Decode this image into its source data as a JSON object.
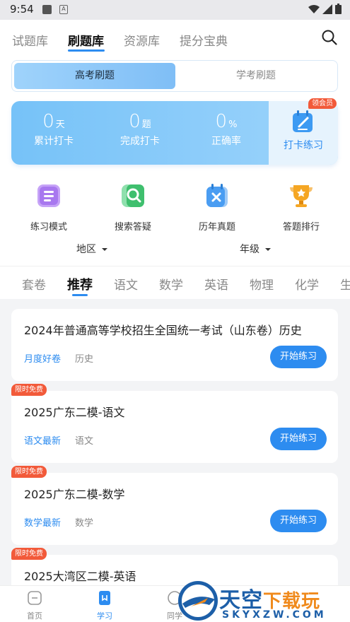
{
  "status_bar": {
    "time": "9:54",
    "sim_icon_letter": "A"
  },
  "top_nav": {
    "tabs": [
      {
        "label": "试题库",
        "active": false
      },
      {
        "label": "刷题库",
        "active": true
      },
      {
        "label": "资源库",
        "active": false
      },
      {
        "label": "提分宝典",
        "active": false
      }
    ],
    "search_icon": "search-icon"
  },
  "segment": {
    "options": [
      "高考刷题",
      "学考刷题"
    ],
    "selected": 0
  },
  "stats": {
    "items": [
      {
        "value": "0",
        "unit": "天",
        "label": "累计打卡"
      },
      {
        "value": "0",
        "unit": "题",
        "label": "完成打卡"
      },
      {
        "value": "0",
        "unit": "%",
        "label": "正确率"
      }
    ],
    "checkin_label": "打卡练习",
    "vip_badge": "领会员"
  },
  "quick_actions": [
    {
      "label": "练习模式",
      "icon": "practice-mode-icon",
      "color": "#b486f3"
    },
    {
      "label": "搜索答疑",
      "icon": "search-answer-icon",
      "color": "#4cc77a"
    },
    {
      "label": "历年真题",
      "icon": "past-papers-icon",
      "color": "#4a9df2"
    },
    {
      "label": "答题排行",
      "icon": "trophy-icon",
      "color": "#f5a623"
    }
  ],
  "filters": {
    "region": "地区",
    "grade": "年级"
  },
  "subject_tabs": [
    "套卷",
    "推荐",
    "语文",
    "数学",
    "英语",
    "物理",
    "化学",
    "生"
  ],
  "subject_tab_active": 1,
  "cards": [
    {
      "title": "2024年普通高等学校招生全国统一考试（山东卷）历史",
      "tag": "月度好卷",
      "subject": "历史",
      "button": "开始练习",
      "badge": ""
    },
    {
      "title": "2025广东二模-语文",
      "tag": "语文最新",
      "subject": "语文",
      "button": "开始练习",
      "badge": "限时免费"
    },
    {
      "title": "2025广东二模-数学",
      "tag": "数学最新",
      "subject": "数学",
      "button": "开始练习",
      "badge": "限时免费"
    },
    {
      "title": "2025大湾区二模-英语",
      "tag": "",
      "subject": "",
      "button": "",
      "badge": "限时免费"
    }
  ],
  "bottom_tabs": [
    {
      "label": "首页",
      "icon": "home-icon",
      "active": false
    },
    {
      "label": "学习",
      "icon": "study-icon",
      "active": true
    },
    {
      "label": "同学",
      "icon": "classmates-icon",
      "active": false
    }
  ],
  "watermark": {
    "cn_main": "天空",
    "cn_accent": "下载玩",
    "en": "SKYXZW.COM"
  },
  "colors": {
    "accent": "#2d8cf0",
    "badge": "#f25a3a",
    "stats_gradient_start": "#76c2f8"
  }
}
